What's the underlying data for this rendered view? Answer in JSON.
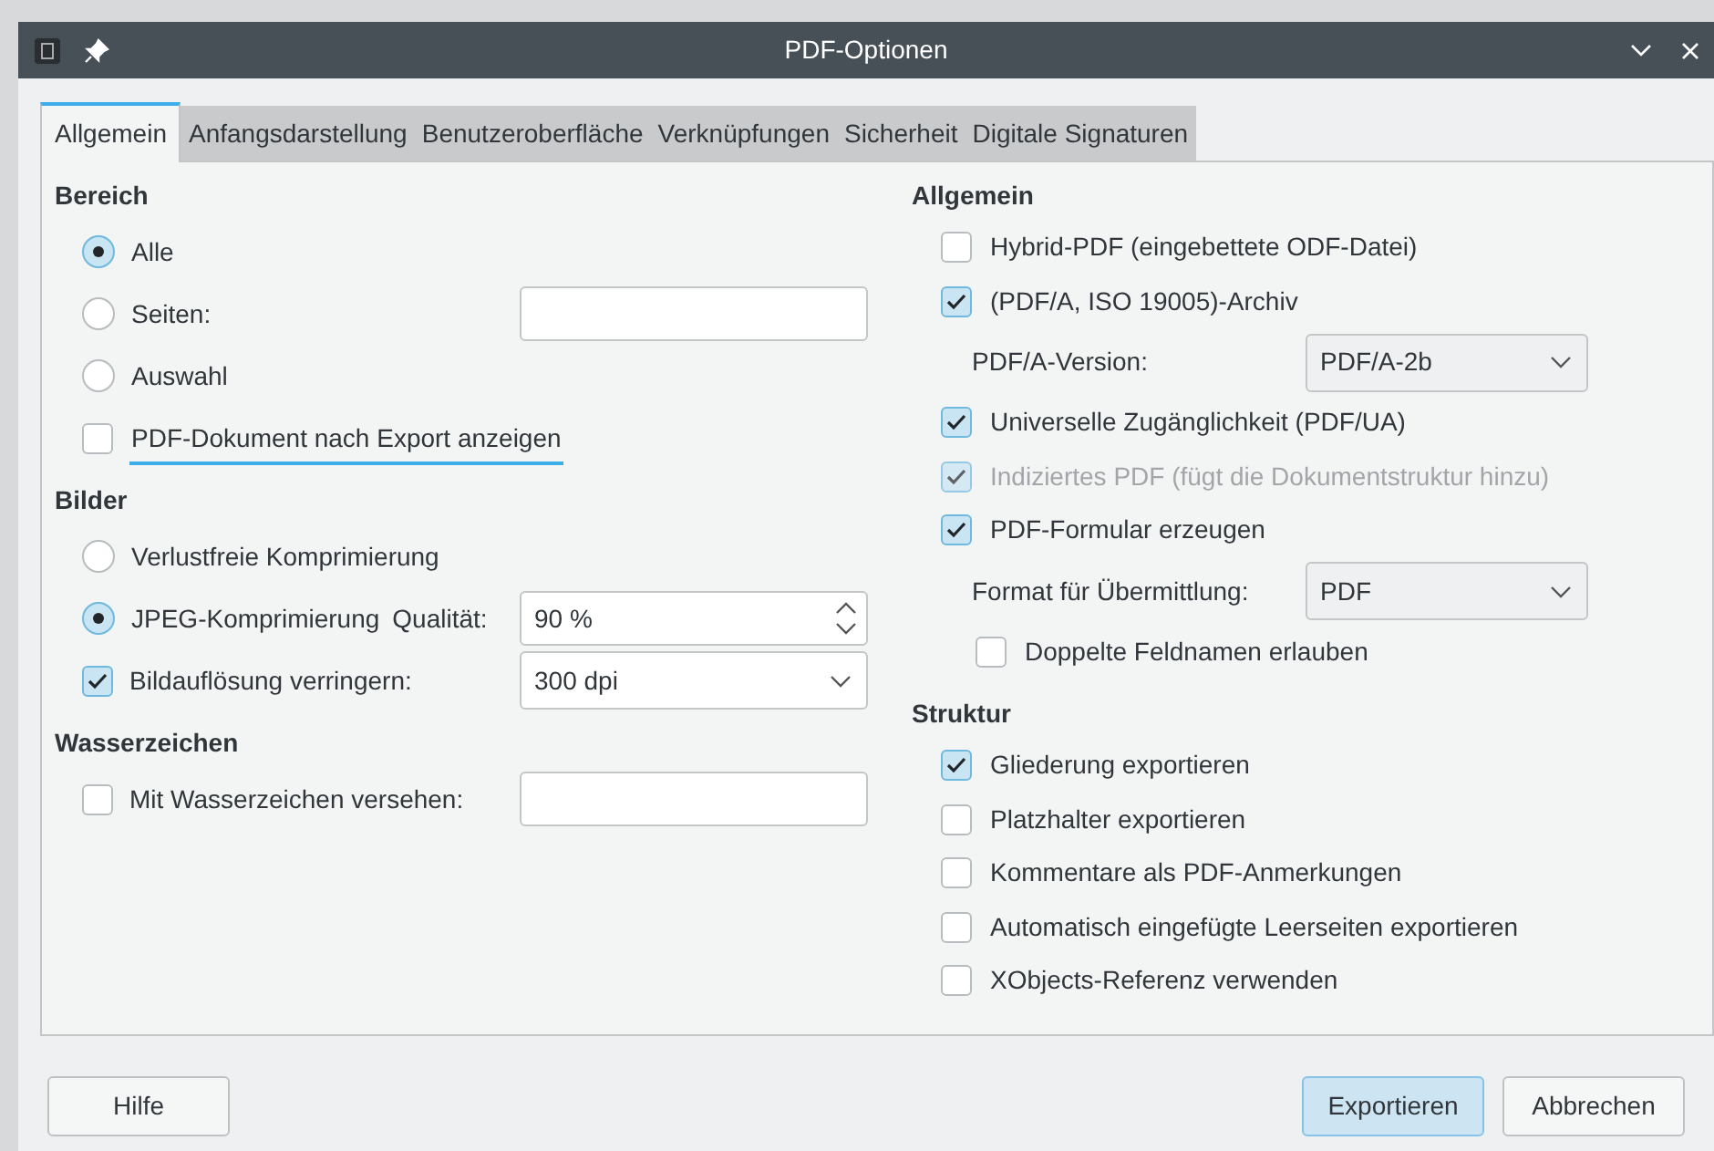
{
  "window": {
    "title": "PDF-Optionen"
  },
  "tabs": [
    {
      "label": "Allgemein",
      "selected": true
    },
    {
      "label": "Anfangsdarstellung",
      "selected": false
    },
    {
      "label": "Benutzeroberfläche",
      "selected": false
    },
    {
      "label": "Verknüpfungen",
      "selected": false
    },
    {
      "label": "Sicherheit",
      "selected": false
    },
    {
      "label": "Digitale Signaturen",
      "selected": false
    }
  ],
  "left_sections": [
    {
      "heading": "Bereich",
      "rows": [
        {
          "kind": "radio",
          "label": "Alle",
          "selected": true
        },
        {
          "kind": "radio_field",
          "label": "Seiten:",
          "selected": false
        },
        {
          "kind": "radio",
          "label": "Auswahl",
          "selected": false
        },
        {
          "kind": "checkbox",
          "label": "PDF-Dokument nach Export anzeigen",
          "checked": false,
          "focused": true
        }
      ]
    },
    {
      "heading": "Bilder",
      "rows": [
        {
          "kind": "radio",
          "label": "Verlustfreie Komprimierung",
          "selected": false
        },
        {
          "kind": "radio_spin",
          "label": "JPEG-Komprimierung",
          "selected": true,
          "field_label": "Qualität:",
          "value": "90 %"
        },
        {
          "kind": "checkbox_select",
          "label": "Bildauflösung verringern:",
          "checked": true,
          "value": "300 dpi"
        }
      ]
    },
    {
      "heading": "Wasserzeichen",
      "rows": [
        {
          "kind": "checkbox_field",
          "label": "Mit Wasserzeichen versehen:",
          "checked": false
        }
      ]
    }
  ],
  "right_sections": [
    {
      "heading": "Allgemein",
      "rows": [
        {
          "kind": "checkbox",
          "label": "Hybrid-PDF (eingebettete ODF-Datei)",
          "checked": false,
          "disabled": false
        },
        {
          "kind": "checkbox",
          "label": "(PDF/A, ISO 19005)-Archiv",
          "checked": true,
          "disabled": false,
          "children": [
            {
              "kind": "select",
              "label": "PDF/A-Version:",
              "value": "PDF/A-2b"
            }
          ]
        },
        {
          "kind": "checkbox",
          "label": "Universelle Zugänglichkeit (PDF/UA)",
          "checked": true,
          "disabled": false
        },
        {
          "kind": "checkbox",
          "label": "Indiziertes PDF (fügt die Dokumentstruktur hinzu)",
          "checked": true,
          "disabled": true
        },
        {
          "kind": "checkbox",
          "label": "PDF-Formular erzeugen",
          "checked": true,
          "disabled": false,
          "children": [
            {
              "kind": "select",
              "label": "Format für Übermittlung:",
              "value": "PDF"
            },
            {
              "kind": "checkbox",
              "label": "Doppelte Feldnamen erlauben",
              "checked": false,
              "disabled": false
            }
          ]
        }
      ]
    },
    {
      "heading": "Struktur",
      "rows": [
        {
          "kind": "checkbox",
          "label": "Gliederung exportieren",
          "checked": true,
          "disabled": false
        },
        {
          "kind": "checkbox",
          "label": "Platzhalter exportieren",
          "checked": false,
          "disabled": false
        },
        {
          "kind": "checkbox",
          "label": "Kommentare als PDF-Anmerkungen",
          "checked": false,
          "disabled": false
        },
        {
          "kind": "checkbox",
          "label": "Automatisch eingefügte Leerseiten exportieren",
          "checked": false,
          "disabled": false
        },
        {
          "kind": "checkbox",
          "label": "XObjects-Referenz verwenden",
          "checked": false,
          "disabled": false
        }
      ]
    }
  ],
  "buttons": [
    {
      "label": "Hilfe",
      "default": false
    },
    {
      "label": "Exportieren",
      "default": true
    },
    {
      "label": "Abbrechen",
      "default": false
    }
  ]
}
